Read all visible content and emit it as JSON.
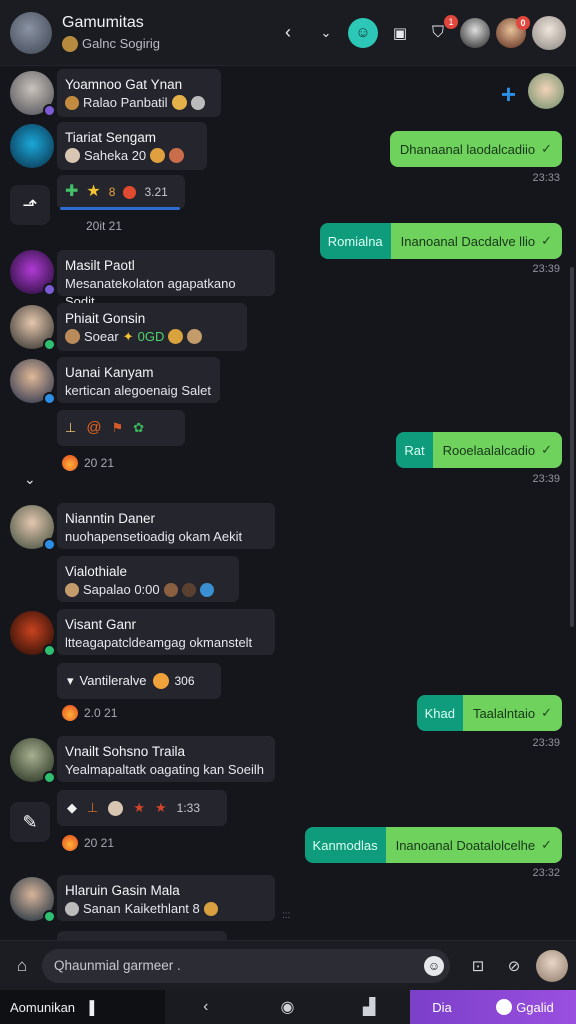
{
  "header": {
    "title": "Gamumitas",
    "subtitle": "Galnc Sogirig",
    "icons": [
      "back-arrow-icon",
      "chevron-down-icon",
      "bot-icon",
      "calendar-icon",
      "shield-check-icon"
    ],
    "shield_badge": "1",
    "avatar_badge": "0"
  },
  "messages_in": [
    {
      "name": "Yoamnoo Gat Ynan",
      "text": "Ralao Panbatil",
      "dot_color": "#7b5cd6"
    },
    {
      "name": "Tiariat Sengam",
      "text": "Saheka 20",
      "dot_color": ""
    },
    {
      "reactions": "3.21",
      "time": "20it 21"
    },
    {
      "name": "Masilt Paotl",
      "text": "Mesanatekolaton agapatkano Sodit",
      "dot_color": "#7b5cd6"
    },
    {
      "name": "Phiait Gonsin",
      "text": "Soear",
      "num": "0GD",
      "dot_color": "#2fbf71"
    },
    {
      "name": "Uanai Kanyam",
      "text": "kertican alegoenaig Salet",
      "dot_color": "#2b8fe5"
    },
    {
      "reactions": "",
      "time": "20 21"
    },
    {
      "name": "Nianntin Daner",
      "text": "nuohapensetioadig okam Aekit",
      "dot_color": "#2b8fe5"
    },
    {
      "name": "Vialothiale",
      "text": "Sapalao 0:00",
      "dot_color": ""
    },
    {
      "name": "Visant Ganr",
      "text": "ltteagapatcldeamgag okmanstelt",
      "dot_color": "#2fbf71"
    },
    {
      "name": "Vantileralve",
      "num": "306",
      "time": "2.0 21"
    },
    {
      "name": "Vnailt Sohsno Traila",
      "text": "Yealmapaltatk oagating kan Soeilh",
      "dot_color": "#2fbf71"
    },
    {
      "reactions": "1:33",
      "time": "20 21"
    },
    {
      "name": "Hlaruin Gasin Mala",
      "text": "Sanan",
      "extra": "Kaikethlant 8",
      "dot_color": "#2fbf71"
    }
  ],
  "messages_out": [
    {
      "tag": "",
      "text": "Dhanaanal laodalcadiio",
      "time": "23:33"
    },
    {
      "tag": "Romialna",
      "text": "Inanoanal Dacdalve llio",
      "time": "23:39"
    },
    {
      "tag": "Rat",
      "text": "Rooelaalalcadio",
      "time": "23:39"
    },
    {
      "tag": "Khad",
      "text": "Taalalntaio",
      "time": "23:39"
    },
    {
      "tag": "Kanmodlas",
      "text": "Inanoanal Doatalolcelhe",
      "time": "23:32"
    }
  ],
  "composer": {
    "placeholder": "Qhaunmial garmeer ."
  },
  "navbar": {
    "left_label": "Aomunikan",
    "right_a": "Dia",
    "right_b": "Ggalid"
  }
}
